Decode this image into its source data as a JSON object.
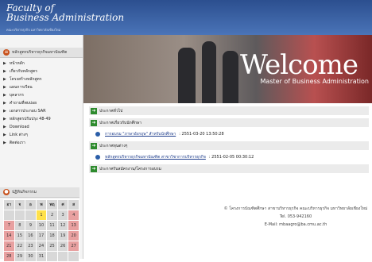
{
  "header": {
    "logo_line1": "Faculty of",
    "logo_line2": "Business Administration",
    "logo_sub": "คณะบริหารธุรกิจ มหาวิทยาลัยเชียงใหม่"
  },
  "banner": {
    "welcome": "Welcome",
    "subtitle": "Master of Business Administration"
  },
  "sidebar": {
    "title": "หลักสูตรบริหารธุรกิจมหาบัณฑิต",
    "items": [
      "หน้าหลัก",
      "เกี่ยวกับหลักสูตร",
      "โครงสร้างหลักสูตร",
      "แผนการเรียน",
      "บุคลากร",
      "คำถามที่พบบ่อย",
      "เอกสารประกอบ SAR",
      "หลักสูตรปรับปรุง 48-49",
      "Download",
      "Link ต่างๆ",
      "ติดต่อเรา"
    ]
  },
  "calendar": {
    "title": "ปฏิทินกิจกรรม",
    "weekdays": [
      "อา",
      "จ",
      "อ",
      "พ",
      "พฤ",
      "ศ",
      "ส"
    ],
    "weeks": [
      [
        "",
        "",
        "",
        "1",
        "2",
        "3",
        "4"
      ],
      [
        "7",
        "8",
        "9",
        "10",
        "11",
        "12",
        "13"
      ],
      [
        "14",
        "15",
        "16",
        "17",
        "18",
        "19",
        "20"
      ],
      [
        "21",
        "22",
        "23",
        "24",
        "25",
        "26",
        "27"
      ],
      [
        "28",
        "29",
        "30",
        "31",
        "",
        "",
        ""
      ]
    ],
    "today": "1"
  },
  "content": {
    "sections": [
      "ประกาศทั่วไป",
      "ประกาศเกี่ยวกับนักศึกษา",
      "ประกาศทุนต่างๆ",
      "ประกาศรับสมัครงาน/โครงการอบรม"
    ],
    "news1": {
      "text": "การอบรม \"ภาษาอังกฤษ\" สำหรับนักศึกษา",
      "date": "2551-03-20 13:50:28"
    },
    "news2": {
      "text": "หลักสูตรบริหารธุรกิจมหาบัณฑิต สาขาวิชาการบริหารธุรกิจ",
      "date": "2551-02-05 00:30:12"
    }
  },
  "footer": {
    "line1": "© โครงการบัณฑิตศึกษา สาขาบริหารธุรกิจ คณะบริหารธุรกิจ มหาวิทยาลัยเชียงใหม่",
    "tel": "Tel. 053-942160",
    "email": "E-Mail: mbaagro@ba.cmu.ac.th"
  },
  "colors": {
    "header": "#2c4f8f",
    "section_icon": "#2e8b2e",
    "menu_icon": "#c8501a",
    "today": "#ffe14a",
    "weekend": "#e8a0a0"
  }
}
